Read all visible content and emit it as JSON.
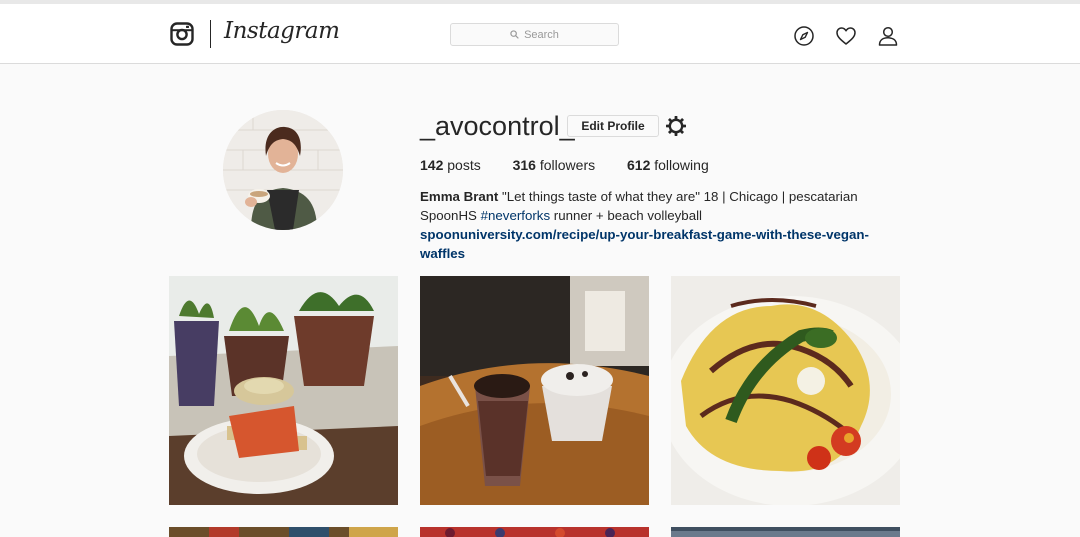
{
  "header": {
    "logo_text": "Instagram",
    "search_placeholder": "Search",
    "icons": [
      "instagram-camera-icon",
      "search-icon",
      "compass-icon",
      "heart-icon",
      "user-icon"
    ]
  },
  "profile": {
    "username": "_avocontrol_",
    "edit_button": "Edit Profile",
    "settings_icon": "gear-icon",
    "stats": {
      "posts_count": "142",
      "posts_label": "posts",
      "followers_count": "316",
      "followers_label": "followers",
      "following_count": "612",
      "following_label": "following"
    },
    "bio": {
      "full_name": "Emma Brant",
      "text_1": " \"Let things taste of what they are\" 18 | Chicago | pescatarian SpoonHS ",
      "hashtag": "#neverforks",
      "text_2": " runner + beach volleyball ",
      "link": "spoonuniversity.com/recipe/up-your-breakfast-game-with-these-vegan-waffles"
    }
  },
  "colors": {
    "background": "#fafafa",
    "text": "#262626",
    "link": "#003569",
    "border": "#dbdbdb"
  }
}
